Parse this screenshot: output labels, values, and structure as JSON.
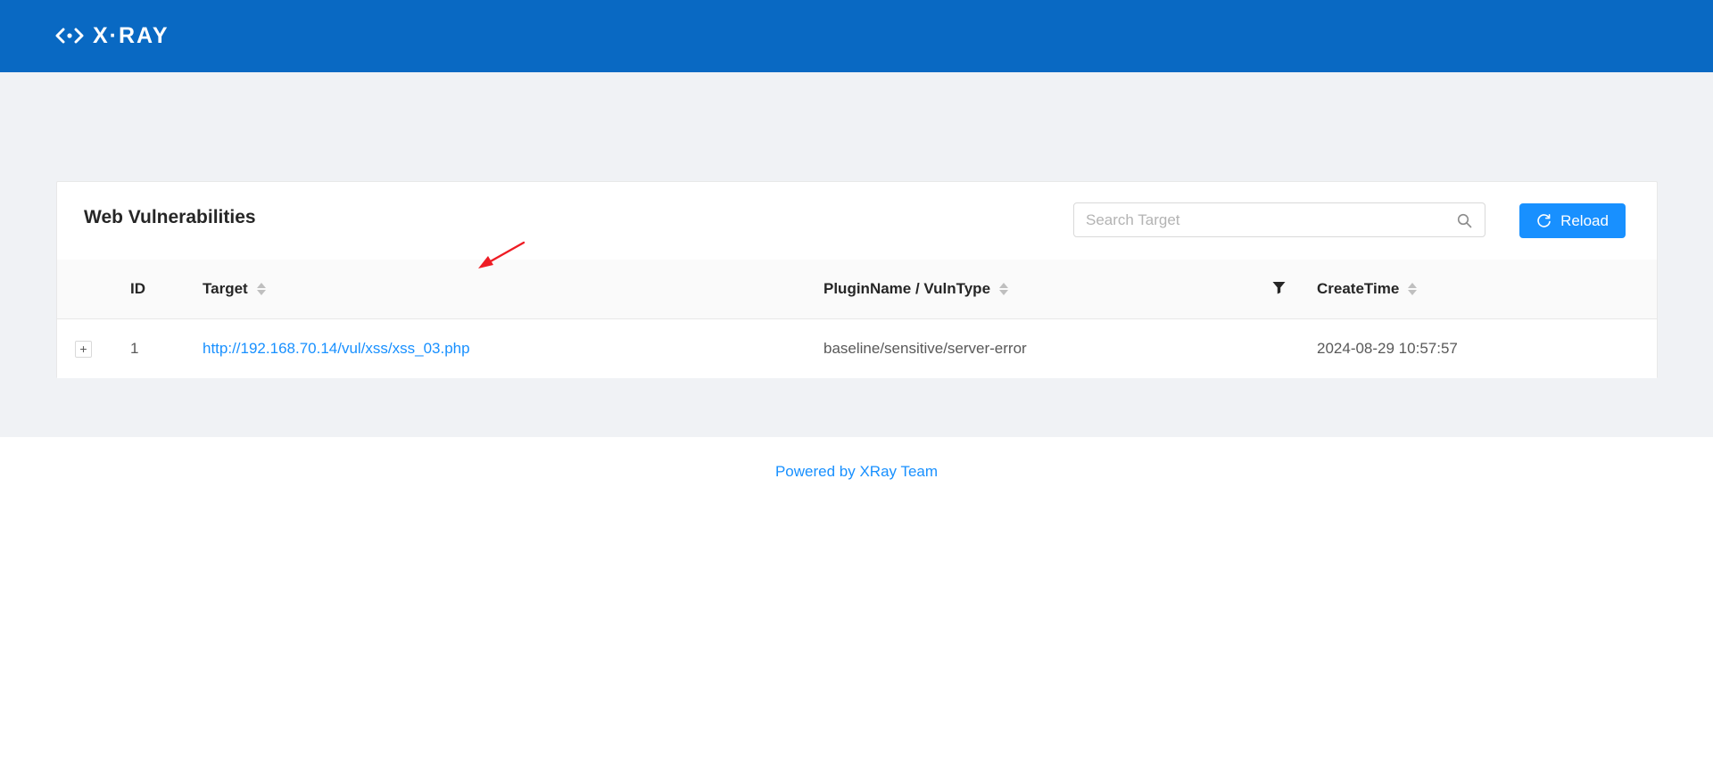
{
  "header": {
    "logo_text": "X·RAY"
  },
  "card": {
    "title": "Web Vulnerabilities"
  },
  "search": {
    "placeholder": "Search Target",
    "value": ""
  },
  "reload_button": {
    "label": "Reload"
  },
  "table": {
    "columns": {
      "id": "ID",
      "target": "Target",
      "plugin": "PluginName / VulnType",
      "create_time": "CreateTime"
    },
    "rows": [
      {
        "expand": "+",
        "id": "1",
        "target": "http://192.168.70.14/vul/xss/xss_03.php",
        "plugin": "baseline/sensitive/server-error",
        "create_time": "2024-08-29 10:57:57"
      }
    ]
  },
  "footer": {
    "text": "Powered by XRay Team"
  },
  "colors": {
    "header_bg": "#0969c3",
    "primary": "#1890ff",
    "page_bg": "#f0f2f5",
    "annotation_arrow": "#ee1c24"
  },
  "icons": [
    "xray-logo-icon",
    "search-icon",
    "reload-icon",
    "sort-icon",
    "filter-icon",
    "plus-icon",
    "arrow-annotation"
  ]
}
